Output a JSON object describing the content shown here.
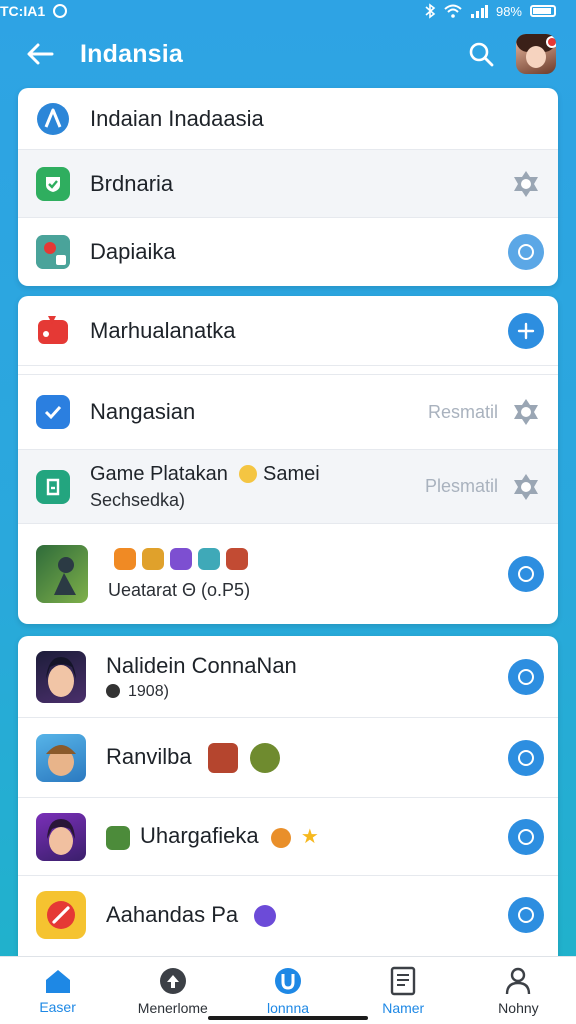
{
  "status_bar": {
    "time": "TC:IA1",
    "battery": "98%"
  },
  "app_bar": {
    "title": "Indansia"
  },
  "section1": [
    {
      "label": "Indaian Inadaasia"
    },
    {
      "label": "Brdnaria"
    },
    {
      "label": "Dapiaika"
    }
  ],
  "section2": [
    {
      "label": "Marhualanatka"
    },
    {
      "label": "Nangasian",
      "trailing": "Resmatil"
    },
    {
      "label": "Game Platakan",
      "label_suffix": "Samei",
      "sub": "Sechsedka)",
      "trailing": "Plesmatil"
    },
    {
      "sub": "Ueatarat Θ (o.P5)"
    }
  ],
  "section3": [
    {
      "label": "Nalidein ConnaNan",
      "sub": "1908)"
    },
    {
      "label": "Ranvilba"
    },
    {
      "label": "Uhargafieka"
    },
    {
      "label": "Aahandas Pa"
    }
  ],
  "bottom_nav": [
    {
      "label": "Easer",
      "icon": "home-icon"
    },
    {
      "label": "Menerlome",
      "icon": "arrow-up-circle-icon"
    },
    {
      "label": "lonnna",
      "icon": "u-shape-icon"
    },
    {
      "label": "Namer",
      "icon": "document-icon"
    },
    {
      "label": "Nohny",
      "icon": "person-icon"
    }
  ],
  "colors": {
    "accent": "#2d8ee0",
    "header": "#2ea3e4"
  }
}
